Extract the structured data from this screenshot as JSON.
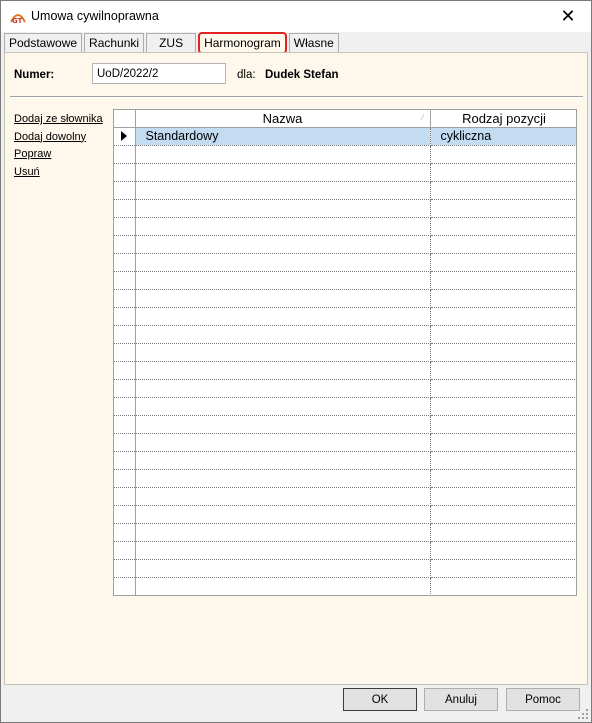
{
  "window": {
    "title": "Umowa cywilnoprawna",
    "close_glyph": "✕"
  },
  "tabs": [
    {
      "label": "Podstawowe",
      "active": false
    },
    {
      "label": "Rachunki",
      "active": false
    },
    {
      "label": "ZUS",
      "active": false
    },
    {
      "label": "Harmonogram",
      "active": true
    },
    {
      "label": "Własne",
      "active": false
    }
  ],
  "header": {
    "numer_label": "Numer:",
    "numer_value": "UoD/2022/2",
    "dla_label": "dla:",
    "dla_value": "Dudek Stefan"
  },
  "actions": [
    {
      "label": "Dodaj ze słownika"
    },
    {
      "label": "Dodaj dowolny"
    },
    {
      "label": "Popraw"
    },
    {
      "label": "Usuń"
    }
  ],
  "grid": {
    "columns": [
      "Nazwa",
      "Rodzaj pozycji"
    ],
    "rows": [
      {
        "nazwa": "Standardowy",
        "rodzaj": "cykliczna",
        "selected": true
      }
    ],
    "empty_rows": 25
  },
  "buttons": {
    "ok": "OK",
    "anuluj": "Anuluj",
    "pomoc": "Pomoc"
  },
  "colors": {
    "panel_bg": "#fdf7ec",
    "selection": "#c3dcf1",
    "active_tab_border": "#e0231f"
  }
}
